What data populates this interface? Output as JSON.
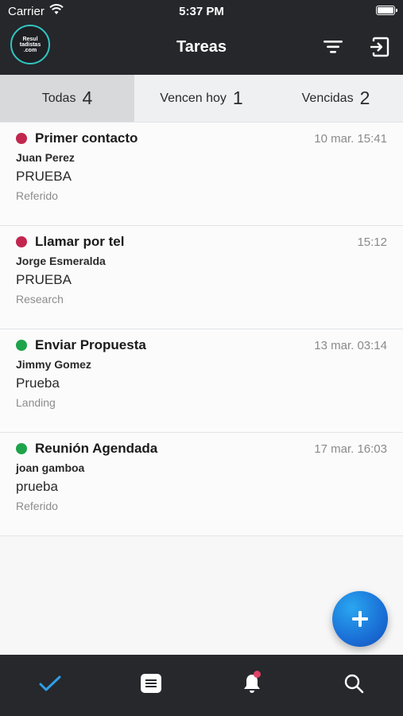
{
  "status_bar": {
    "carrier": "Carrier",
    "time": "5:37 PM"
  },
  "header": {
    "logo_line1": "Resul",
    "logo_line2": "tadistas",
    "logo_line3": ".com",
    "title": "Tareas"
  },
  "tabs": [
    {
      "label": "Todas",
      "count": "4"
    },
    {
      "label": "Vencen hoy",
      "count": "1"
    },
    {
      "label": "Vencidas",
      "count": "2"
    }
  ],
  "tasks": [
    {
      "title": "Primer contacto",
      "date": "10 mar. 15:41",
      "person": "Juan Perez",
      "description": "PRUEBA",
      "source": "Referido",
      "status_color": "#c2264f"
    },
    {
      "title": "Llamar por tel",
      "date": "15:12",
      "person": "Jorge Esmeralda",
      "description": "PRUEBA",
      "source": "Research",
      "status_color": "#c2264f"
    },
    {
      "title": "Enviar Propuesta",
      "date": "13 mar. 03:14",
      "person": "Jimmy Gomez",
      "description": "Prueba",
      "source": "Landing",
      "status_color": "#1fa34a"
    },
    {
      "title": "Reunión Agendada",
      "date": "17 mar. 16:03",
      "person": "joan gamboa",
      "description": "prueba",
      "source": "Referido",
      "status_color": "#1fa34a"
    }
  ],
  "colors": {
    "accent": "#1a6fd6",
    "header_bg": "#25272b",
    "logo_ring": "#32c5c0",
    "nav_active": "#2f9ee8",
    "notification_dot": "#e0426a"
  },
  "nav": [
    {
      "icon": "check-icon",
      "active": true
    },
    {
      "icon": "notes-icon",
      "active": false
    },
    {
      "icon": "bell-icon",
      "active": false,
      "badge": true
    },
    {
      "icon": "search-icon",
      "active": false
    }
  ]
}
